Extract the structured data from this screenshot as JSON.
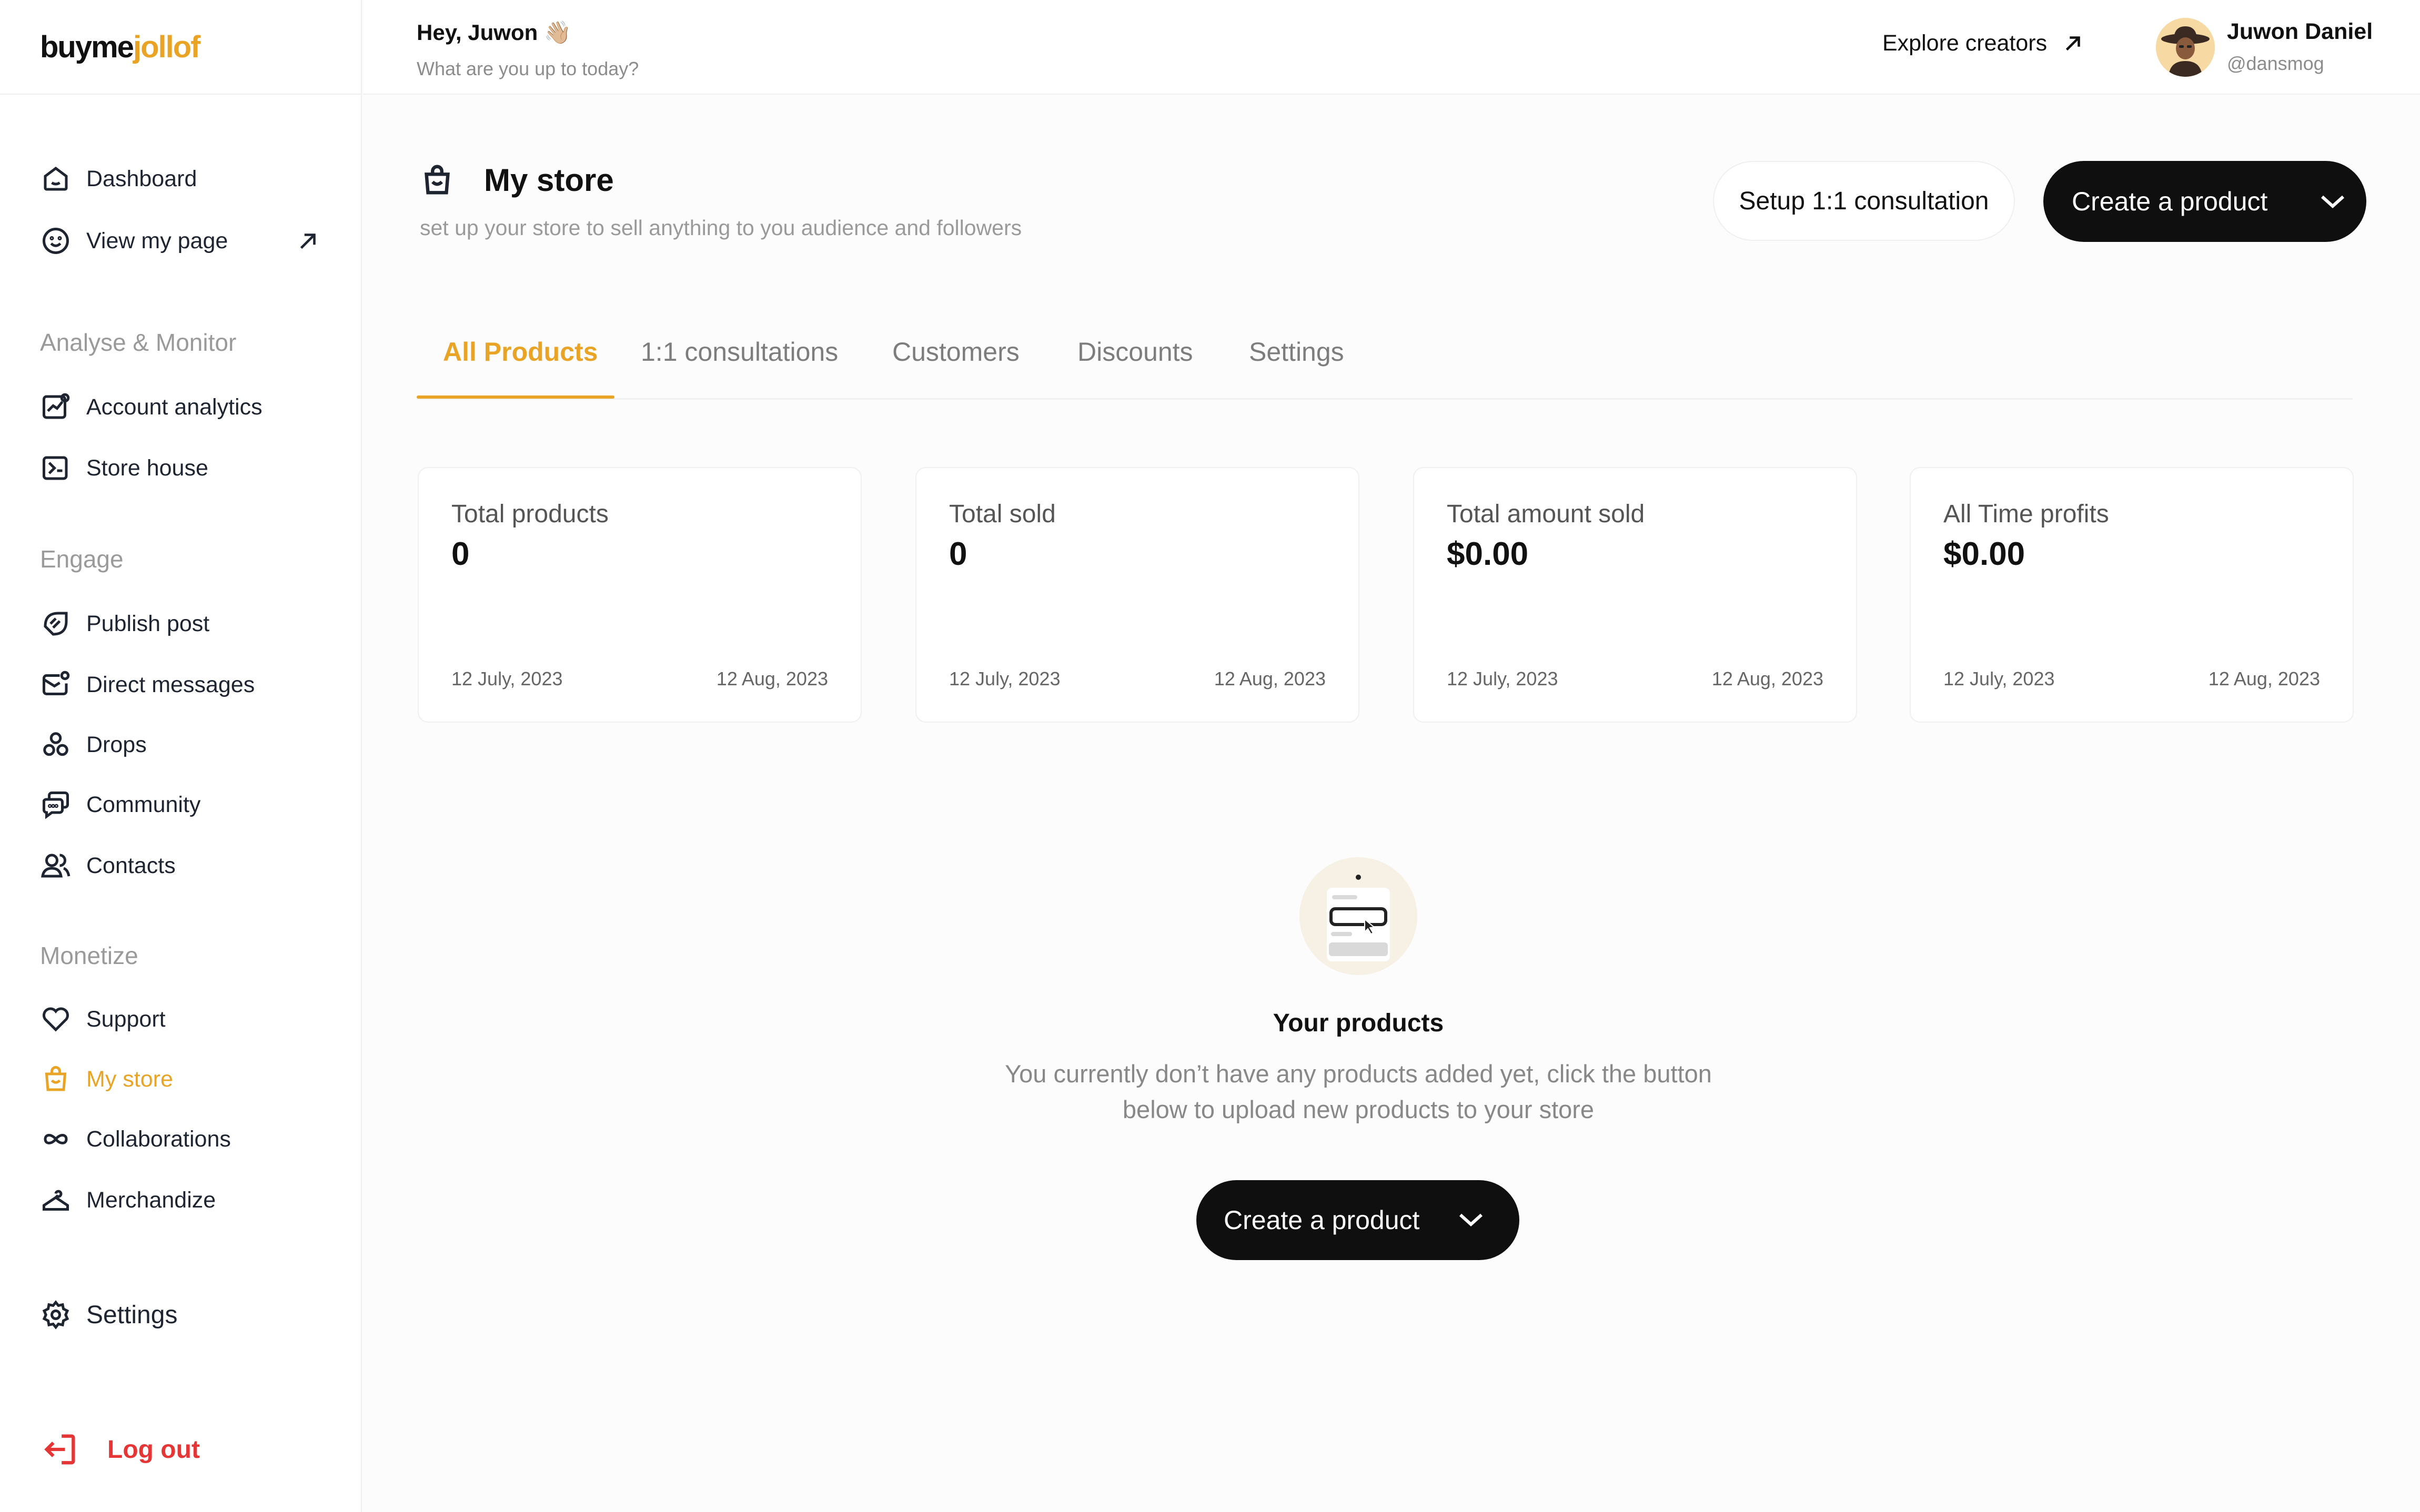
{
  "brand": {
    "part1": "buyme",
    "part2": "jollof"
  },
  "header": {
    "greeting": "Hey, Juwon 👋🏼",
    "subtitle": "What are you up to today?",
    "explore_label": "Explore creators",
    "user_name": "Juwon Daniel",
    "user_handle": "@dansmog"
  },
  "sidebar": {
    "top": [
      {
        "label": "Dashboard",
        "icon": "home-icon"
      },
      {
        "label": "View my page",
        "icon": "smiley-icon"
      }
    ],
    "sections": [
      {
        "label": "Analyse & Monitor",
        "items": [
          {
            "label": "Account analytics",
            "icon": "analytics-icon"
          },
          {
            "label": "Store house",
            "icon": "store-house-icon"
          }
        ]
      },
      {
        "label": "Engage",
        "items": [
          {
            "label": "Publish post",
            "icon": "publish-icon"
          },
          {
            "label": "Direct messages",
            "icon": "message-icon"
          },
          {
            "label": "Drops",
            "icon": "drops-icon"
          },
          {
            "label": "Community",
            "icon": "community-icon"
          },
          {
            "label": "Contacts",
            "icon": "contacts-icon"
          }
        ]
      },
      {
        "label": "Monetize",
        "items": [
          {
            "label": "Support",
            "icon": "heart-icon"
          },
          {
            "label": "My store",
            "icon": "bag-icon"
          },
          {
            "label": "Collaborations",
            "icon": "infinity-icon"
          },
          {
            "label": "Merchandize",
            "icon": "hanger-icon"
          }
        ]
      }
    ],
    "settings_label": "Settings",
    "logout_label": "Log out"
  },
  "main": {
    "title": "My store",
    "subtitle": "set up your store to sell anything to you audience and followers",
    "setup_button": "Setup 1:1 consultation",
    "create_button": "Create a product",
    "tabs": [
      "All Products",
      "1:1 consultations",
      "Customers",
      "Discounts",
      "Settings"
    ],
    "active_tab": "All Products",
    "stats": [
      {
        "title": "Total products",
        "value": "0",
        "from": "12 July, 2023",
        "to": "12 Aug, 2023"
      },
      {
        "title": "Total sold",
        "value": "0",
        "from": "12 July, 2023",
        "to": "12 Aug, 2023"
      },
      {
        "title": "Total amount sold",
        "value": "$0.00",
        "from": "12 July, 2023",
        "to": "12 Aug, 2023"
      },
      {
        "title": "All Time profits",
        "value": "$0.00",
        "from": "12 July, 2023",
        "to": "12 Aug, 2023"
      }
    ],
    "empty": {
      "title": "Your products",
      "line1": "You currently don’t have any products added yet, click the button",
      "line2": "below to upload new products to your store",
      "button": "Create a product"
    }
  },
  "colors": {
    "accent": "#e9a426",
    "danger": "#e53535",
    "dark_button": "#0f0f0f"
  }
}
